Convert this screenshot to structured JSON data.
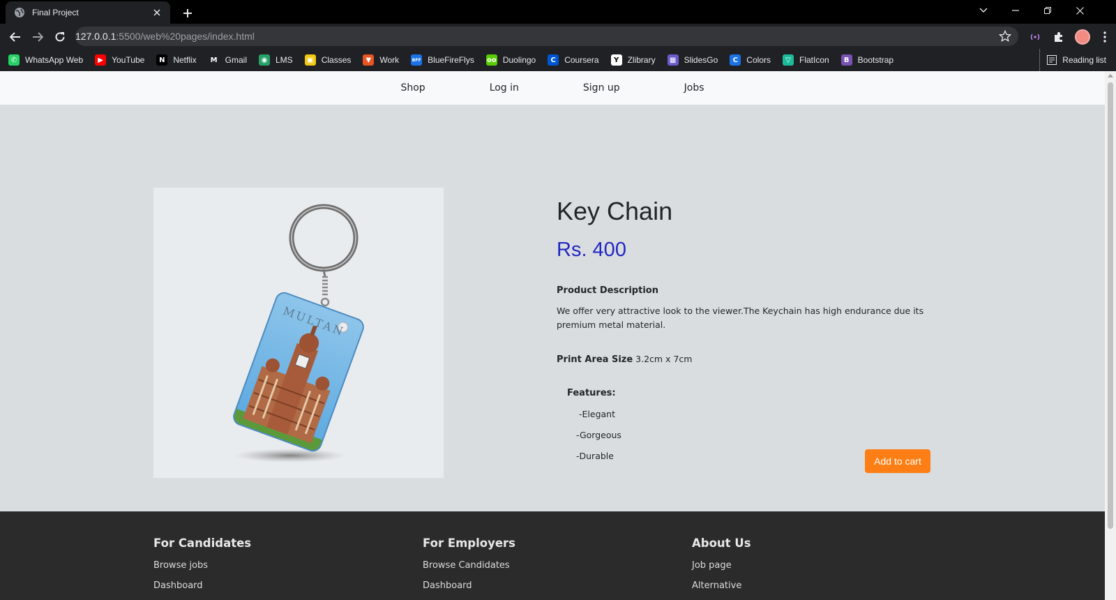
{
  "browser": {
    "tab_title": "Final Project",
    "url_host": "127.0.0.1",
    "url_rest": ":5500/web%20pages/index.html",
    "bookmarks": [
      {
        "label": "WhatsApp Web",
        "icon": "whatsapp-icon",
        "color": "#25d366",
        "glyph": "✆"
      },
      {
        "label": "YouTube",
        "icon": "youtube-icon",
        "color": "#ff0000",
        "glyph": "▶"
      },
      {
        "label": "Netflix",
        "icon": "netflix-icon",
        "color": "#000000",
        "glyph": "N"
      },
      {
        "label": "Gmail",
        "icon": "gmail-icon",
        "color": "#202124",
        "glyph": "M"
      },
      {
        "label": "LMS",
        "icon": "lms-icon",
        "color": "#26a269",
        "glyph": "◉"
      },
      {
        "label": "Classes",
        "icon": "classes-icon",
        "color": "#f2c811",
        "glyph": "▣"
      },
      {
        "label": "Work",
        "icon": "work-icon",
        "color": "#e95420",
        "glyph": "▼"
      },
      {
        "label": "BlueFireFlys",
        "icon": "bluefireflys-icon",
        "color": "#1a73e8",
        "glyph": "BFF"
      },
      {
        "label": "Duolingo",
        "icon": "duolingo-icon",
        "color": "#58cc02",
        "glyph": "oo"
      },
      {
        "label": "Coursera",
        "icon": "coursera-icon",
        "color": "#0056d2",
        "glyph": "C"
      },
      {
        "label": "Zlibrary",
        "icon": "zlibrary-icon",
        "color": "#ffffff",
        "glyph": "Y"
      },
      {
        "label": "SlidesGo",
        "icon": "slidesgo-icon",
        "color": "#6a5acd",
        "glyph": "▦"
      },
      {
        "label": "Colors",
        "icon": "colors-icon",
        "color": "#1a73e8",
        "glyph": "C"
      },
      {
        "label": "FlatIcon",
        "icon": "flaticon-icon",
        "color": "#1abc9c",
        "glyph": "▽"
      },
      {
        "label": "Bootstrap",
        "icon": "bootstrap-icon",
        "color": "#7952b3",
        "glyph": "B"
      }
    ],
    "reading_list": "Reading list"
  },
  "nav": [
    "Shop",
    "Log in",
    "Sign up",
    "Jobs"
  ],
  "product": {
    "title": "Key Chain",
    "price": "Rs. 400",
    "desc_heading": "Product Description",
    "desc": "We offer very attractive look to the viewer.The Keychain has high endurance due its premium metal material.",
    "print_label": "Print Area Size",
    "print_value": "3.2cm x 7cm",
    "features_heading": "Features:",
    "features": [
      "-Elegant",
      "-Gorgeous",
      "-Durable"
    ],
    "cart_button": "Add to cart",
    "keychain_text": "MULTAN"
  },
  "footer": {
    "cols": [
      {
        "title": "For Candidates",
        "links": [
          "Browse jobs",
          "Dashboard"
        ]
      },
      {
        "title": "For Employers",
        "links": [
          "Browse Candidates",
          "Dashboard"
        ]
      },
      {
        "title": "About Us",
        "links": [
          "Job page",
          "Alternative"
        ]
      }
    ]
  },
  "colors": {
    "price": "#2227c1",
    "cart_button": "#fd7e14",
    "footer_bg": "#2b2b2b"
  }
}
